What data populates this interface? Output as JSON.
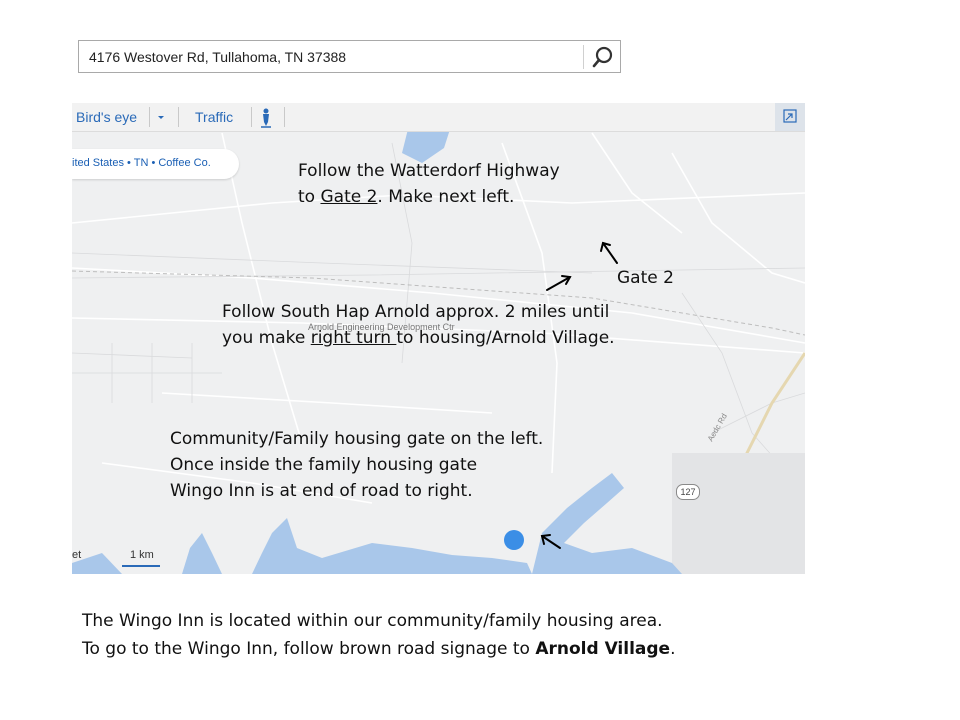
{
  "search": {
    "query": "4176 Westover Rd, Tullahoma, TN 37388",
    "icon": "search-icon"
  },
  "map": {
    "toolbar": {
      "birds_eye": "Bird's eye",
      "traffic": "Traffic",
      "dropdown_icon": "chevron-down-icon",
      "person_icon": "person-icon",
      "expand_icon": "expand-icon"
    },
    "breadcrumb": "ited States • TN • Coffee Co.",
    "place_label": "Arnold Engineering Development Ctr",
    "road_label": "Aedc Rd",
    "route_shield": "127",
    "scale": {
      "unit_left": "et",
      "unit_right": "1 km"
    },
    "colors": {
      "water": "#a9c7ea",
      "location_dot": "#3b8ee6",
      "land": "#eff0f1",
      "accent": "#2a6ab8"
    }
  },
  "annotations": {
    "step1": {
      "line1": "Follow the Watterdorf Highway",
      "line2_prefix": "to ",
      "line2_link": "Gate 2",
      "line2_suffix": ". Make next left."
    },
    "gate_label": "Gate 2",
    "step2": {
      "line1": "Follow South Hap Arnold approx. 2 miles until",
      "line2_prefix": "you make ",
      "line2_underlined": "right turn ",
      "line2_suffix": "to housing/Arnold Village."
    },
    "step3": {
      "line1": "Community/Family housing gate on the left.",
      "line2": "Once inside the family housing gate",
      "line3": "Wingo Inn is at end of road to right."
    }
  },
  "caption": {
    "line1": "The Wingo Inn is located within our community/family housing area.",
    "line2_prefix": "To go to the Wingo Inn, follow brown road signage to ",
    "line2_bold": "Arnold Village",
    "line2_suffix": "."
  }
}
